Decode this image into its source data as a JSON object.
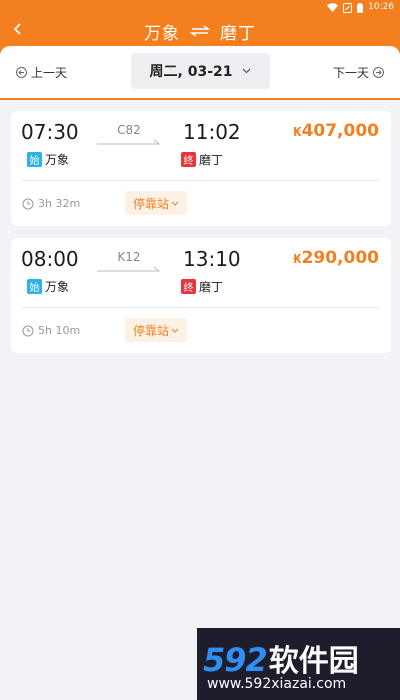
{
  "status_bar": {
    "time": "10:26"
  },
  "header": {
    "from_city": "万象",
    "to_city": "磨丁"
  },
  "date_bar": {
    "prev_day_label": "上一天",
    "next_day_label": "下一天",
    "selected_date": "周二, 03-21"
  },
  "trains": [
    {
      "departure_time": "07:30",
      "arrival_time": "11:02",
      "train_number": "C82",
      "price_currency": "₭",
      "price_value": "407,000",
      "from_badge": "始",
      "from_station": "万象",
      "to_badge": "终",
      "to_station": "磨丁",
      "duration": "3h 32m",
      "stops_label": "停靠站"
    },
    {
      "departure_time": "08:00",
      "arrival_time": "13:10",
      "train_number": "K12",
      "price_currency": "₭",
      "price_value": "290,000",
      "from_badge": "始",
      "from_station": "万象",
      "to_badge": "终",
      "to_station": "磨丁",
      "duration": "5h 10m",
      "stops_label": "停靠站"
    }
  ],
  "watermark": {
    "logo_digits": "592",
    "logo_text": "软件园",
    "url": "www.592xiazai.com"
  },
  "colors": {
    "accent": "#f47f1f",
    "start_badge": "#2bb2e8",
    "end_badge": "#e8343a",
    "background": "#f2f3f7"
  }
}
